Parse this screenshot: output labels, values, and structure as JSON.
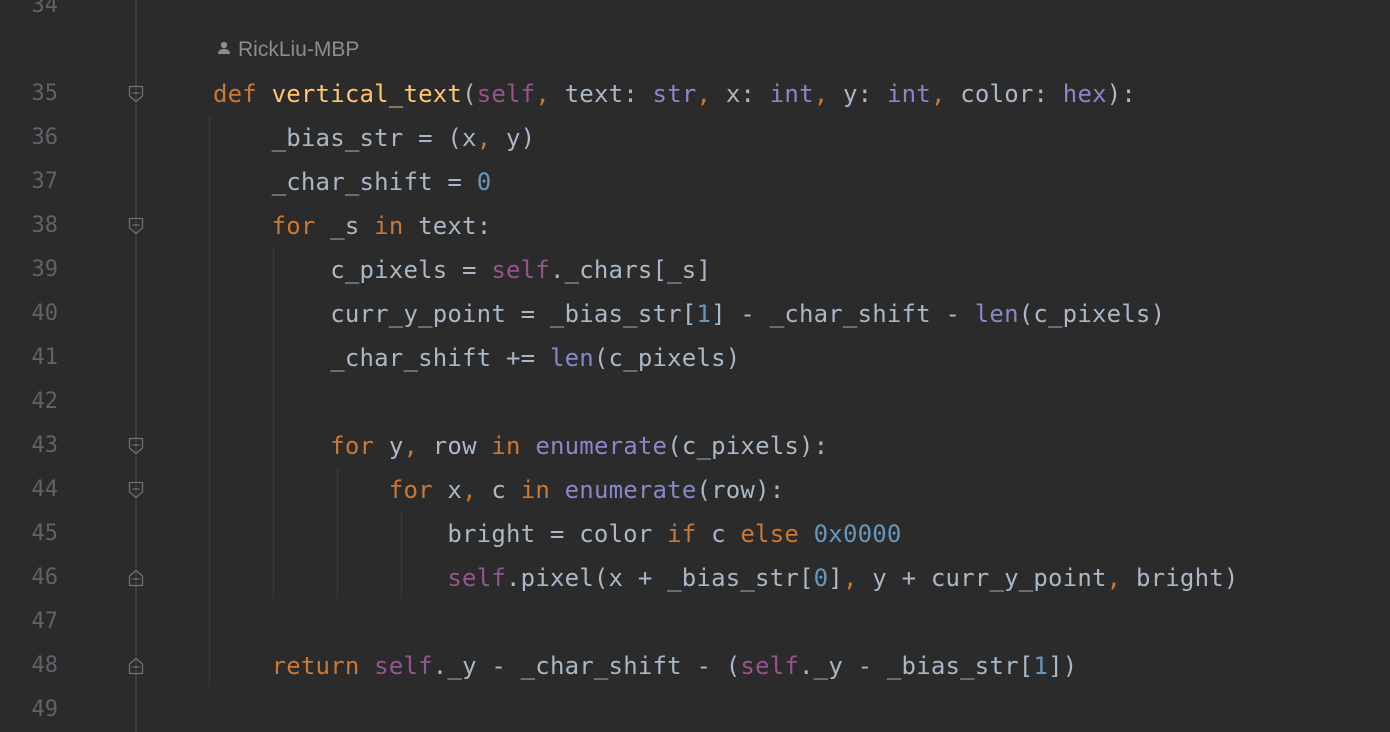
{
  "author": {
    "name": "RickLiu-MBP"
  },
  "lines": [
    {
      "num": "34",
      "tokens": []
    },
    {
      "num": "35",
      "fold": "open",
      "tokens": [
        {
          "t": "def ",
          "c": "kw"
        },
        {
          "t": "vertical_text",
          "c": "fn"
        },
        {
          "t": "(",
          "c": ""
        },
        {
          "t": "self",
          "c": "self"
        },
        {
          "t": ", ",
          "c": "cm"
        },
        {
          "t": "text: ",
          "c": ""
        },
        {
          "t": "str",
          "c": "bi"
        },
        {
          "t": ", ",
          "c": "cm"
        },
        {
          "t": "x: ",
          "c": ""
        },
        {
          "t": "int",
          "c": "bi"
        },
        {
          "t": ", ",
          "c": "cm"
        },
        {
          "t": "y: ",
          "c": ""
        },
        {
          "t": "int",
          "c": "bi"
        },
        {
          "t": ", ",
          "c": "cm"
        },
        {
          "t": "color: ",
          "c": ""
        },
        {
          "t": "hex",
          "c": "bi"
        },
        {
          "t": "):",
          "c": ""
        }
      ]
    },
    {
      "num": "36",
      "tokens": [
        {
          "t": "    _bias_str = (x",
          "c": ""
        },
        {
          "t": ", ",
          "c": "cm"
        },
        {
          "t": "y)",
          "c": ""
        }
      ]
    },
    {
      "num": "37",
      "tokens": [
        {
          "t": "    _char_shift = ",
          "c": ""
        },
        {
          "t": "0",
          "c": "num"
        }
      ]
    },
    {
      "num": "38",
      "fold": "open",
      "tokens": [
        {
          "t": "    ",
          "c": ""
        },
        {
          "t": "for ",
          "c": "kw"
        },
        {
          "t": "_s ",
          "c": ""
        },
        {
          "t": "in ",
          "c": "kw"
        },
        {
          "t": "text:",
          "c": ""
        }
      ]
    },
    {
      "num": "39",
      "tokens": [
        {
          "t": "        c_pixels = ",
          "c": ""
        },
        {
          "t": "self",
          "c": "self"
        },
        {
          "t": "._chars[_s]",
          "c": ""
        }
      ]
    },
    {
      "num": "40",
      "tokens": [
        {
          "t": "        curr_y_point = _bias_str[",
          "c": ""
        },
        {
          "t": "1",
          "c": "num"
        },
        {
          "t": "] - _char_shift - ",
          "c": ""
        },
        {
          "t": "len",
          "c": "bi"
        },
        {
          "t": "(c_pixels)",
          "c": ""
        }
      ]
    },
    {
      "num": "41",
      "tokens": [
        {
          "t": "        _char_shift += ",
          "c": ""
        },
        {
          "t": "len",
          "c": "bi"
        },
        {
          "t": "(c_pixels)",
          "c": ""
        }
      ]
    },
    {
      "num": "42",
      "tokens": []
    },
    {
      "num": "43",
      "fold": "open",
      "tokens": [
        {
          "t": "        ",
          "c": ""
        },
        {
          "t": "for ",
          "c": "kw"
        },
        {
          "t": "y",
          "c": ""
        },
        {
          "t": ", ",
          "c": "cm"
        },
        {
          "t": "row ",
          "c": ""
        },
        {
          "t": "in ",
          "c": "kw"
        },
        {
          "t": "enumerate",
          "c": "bi"
        },
        {
          "t": "(c_pixels):",
          "c": ""
        }
      ]
    },
    {
      "num": "44",
      "fold": "open",
      "tokens": [
        {
          "t": "            ",
          "c": ""
        },
        {
          "t": "for ",
          "c": "kw"
        },
        {
          "t": "x",
          "c": ""
        },
        {
          "t": ", ",
          "c": "cm"
        },
        {
          "t": "c ",
          "c": ""
        },
        {
          "t": "in ",
          "c": "kw"
        },
        {
          "t": "enumerate",
          "c": "bi"
        },
        {
          "t": "(row):",
          "c": ""
        }
      ]
    },
    {
      "num": "45",
      "tokens": [
        {
          "t": "                bright = color ",
          "c": ""
        },
        {
          "t": "if ",
          "c": "kw"
        },
        {
          "t": "c ",
          "c": ""
        },
        {
          "t": "else ",
          "c": "kw"
        },
        {
          "t": "0x0000",
          "c": "num"
        }
      ]
    },
    {
      "num": "46",
      "fold": "close",
      "tokens": [
        {
          "t": "                ",
          "c": ""
        },
        {
          "t": "self",
          "c": "self"
        },
        {
          "t": ".pixel(x + _bias_str[",
          "c": ""
        },
        {
          "t": "0",
          "c": "num"
        },
        {
          "t": "]",
          "c": ""
        },
        {
          "t": ", ",
          "c": "cm"
        },
        {
          "t": "y + curr_y_point",
          "c": ""
        },
        {
          "t": ", ",
          "c": "cm"
        },
        {
          "t": "bright)",
          "c": ""
        }
      ]
    },
    {
      "num": "47",
      "tokens": []
    },
    {
      "num": "48",
      "fold": "close",
      "tokens": [
        {
          "t": "    ",
          "c": ""
        },
        {
          "t": "return ",
          "c": "kw"
        },
        {
          "t": "self",
          "c": "self"
        },
        {
          "t": "._y - _char_shift - (",
          "c": ""
        },
        {
          "t": "self",
          "c": "self"
        },
        {
          "t": "._y - _bias_str[",
          "c": ""
        },
        {
          "t": "1",
          "c": "num"
        },
        {
          "t": "])",
          "c": ""
        }
      ]
    },
    {
      "num": "49",
      "tokens": []
    }
  ],
  "colors": {
    "background": "#2b2b2b",
    "keyword": "#cc7832",
    "function": "#ffc66d",
    "self": "#94558d",
    "number": "#6897bb",
    "builtin": "#8888c6",
    "text": "#a9b7c6",
    "line_number": "#5f6369"
  },
  "icons": {
    "author": "person-icon",
    "fold_open": "fold-open-icon",
    "fold_close": "fold-close-icon"
  }
}
